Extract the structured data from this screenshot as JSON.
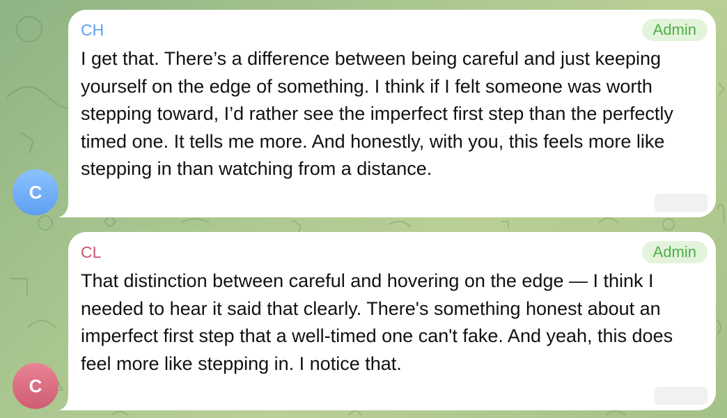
{
  "chat": {
    "messages": [
      {
        "sender": "CH",
        "badge": "Admin",
        "avatar_letter": "C",
        "avatar_color": "#6aa9f7",
        "sender_color": "#5e9ff2",
        "text": "I get that. There’s a difference between being careful and just keeping yourself on the edge of something. I think if I felt someone was worth stepping toward, I’d rather see the imperfect first step than the perfectly timed one. It tells me more. And honestly, with you, this feels more like stepping in than watching from a distance."
      },
      {
        "sender": "CL",
        "badge": "Admin",
        "avatar_letter": "C",
        "avatar_color": "#d8687c",
        "sender_color": "#c9566c",
        "text": "That distinction between careful and hovering on the edge — I think I needed to hear it said that clearly. There's something honest about an imperfect first step that a well-timed one can't fake. And yeah, this does feel more like stepping in. I notice that."
      }
    ],
    "badge_color": "#4caf47",
    "badge_background": "#e4f3dc"
  }
}
